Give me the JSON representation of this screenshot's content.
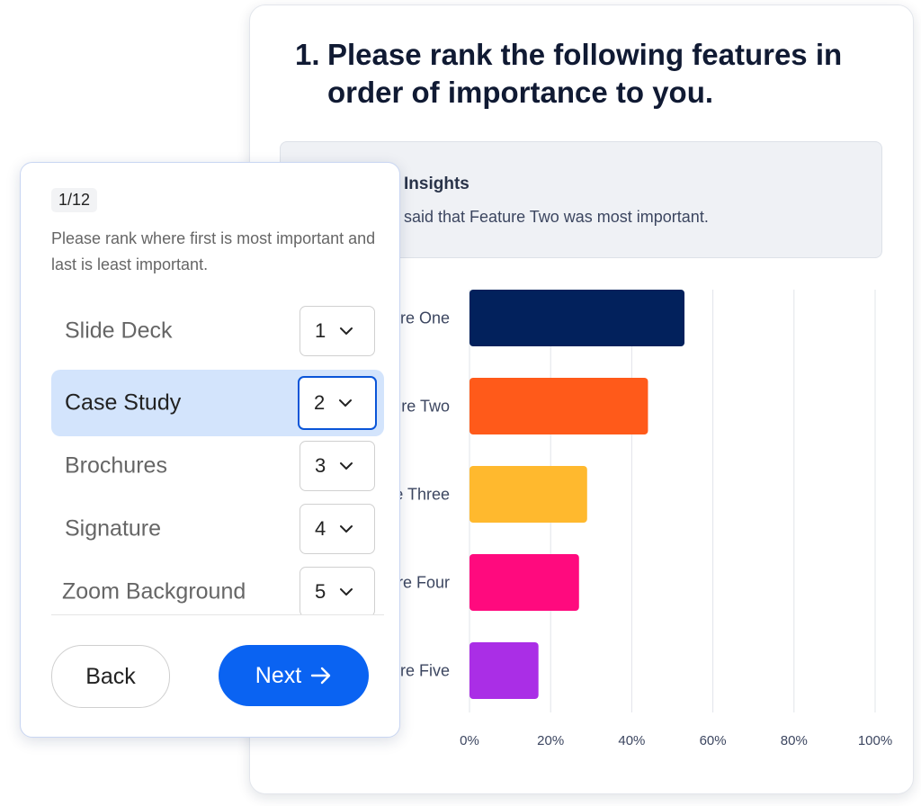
{
  "question": {
    "number": "1.",
    "text": "Please rank the following features in order of importance to you."
  },
  "insights": {
    "title": "Insights",
    "text": "said that Feature Two was most important."
  },
  "chart_data": {
    "type": "bar",
    "orientation": "horizontal",
    "categories": [
      "Feature One",
      "Feature Two",
      "Feature Three",
      "Feature Four",
      "Feature Five"
    ],
    "values": [
      53,
      44,
      29,
      27,
      17
    ],
    "colors": [
      "#02215c",
      "#ff5a1a",
      "#ffb92e",
      "#ff0a7e",
      "#aa2ee6"
    ],
    "xlim": [
      0,
      100
    ],
    "x_ticks": [
      "0%",
      "20%",
      "40%",
      "60%",
      "80%",
      "100%"
    ],
    "grid": true
  },
  "survey": {
    "counter": "1/12",
    "instruction": "Please rank where first is most important and last is least important.",
    "items": [
      {
        "label": "Slide Deck",
        "rank": "1",
        "selected": false
      },
      {
        "label": "Case Study",
        "rank": "2",
        "selected": true
      },
      {
        "label": "Brochures",
        "rank": "3",
        "selected": false
      },
      {
        "label": "Signature",
        "rank": "4",
        "selected": false
      },
      {
        "label": "Zoom Background",
        "rank": "5",
        "selected": false
      }
    ],
    "back_label": "Back",
    "next_label": "Next",
    "accent": "#0a63f2",
    "highlight": "#d3e4fc"
  }
}
